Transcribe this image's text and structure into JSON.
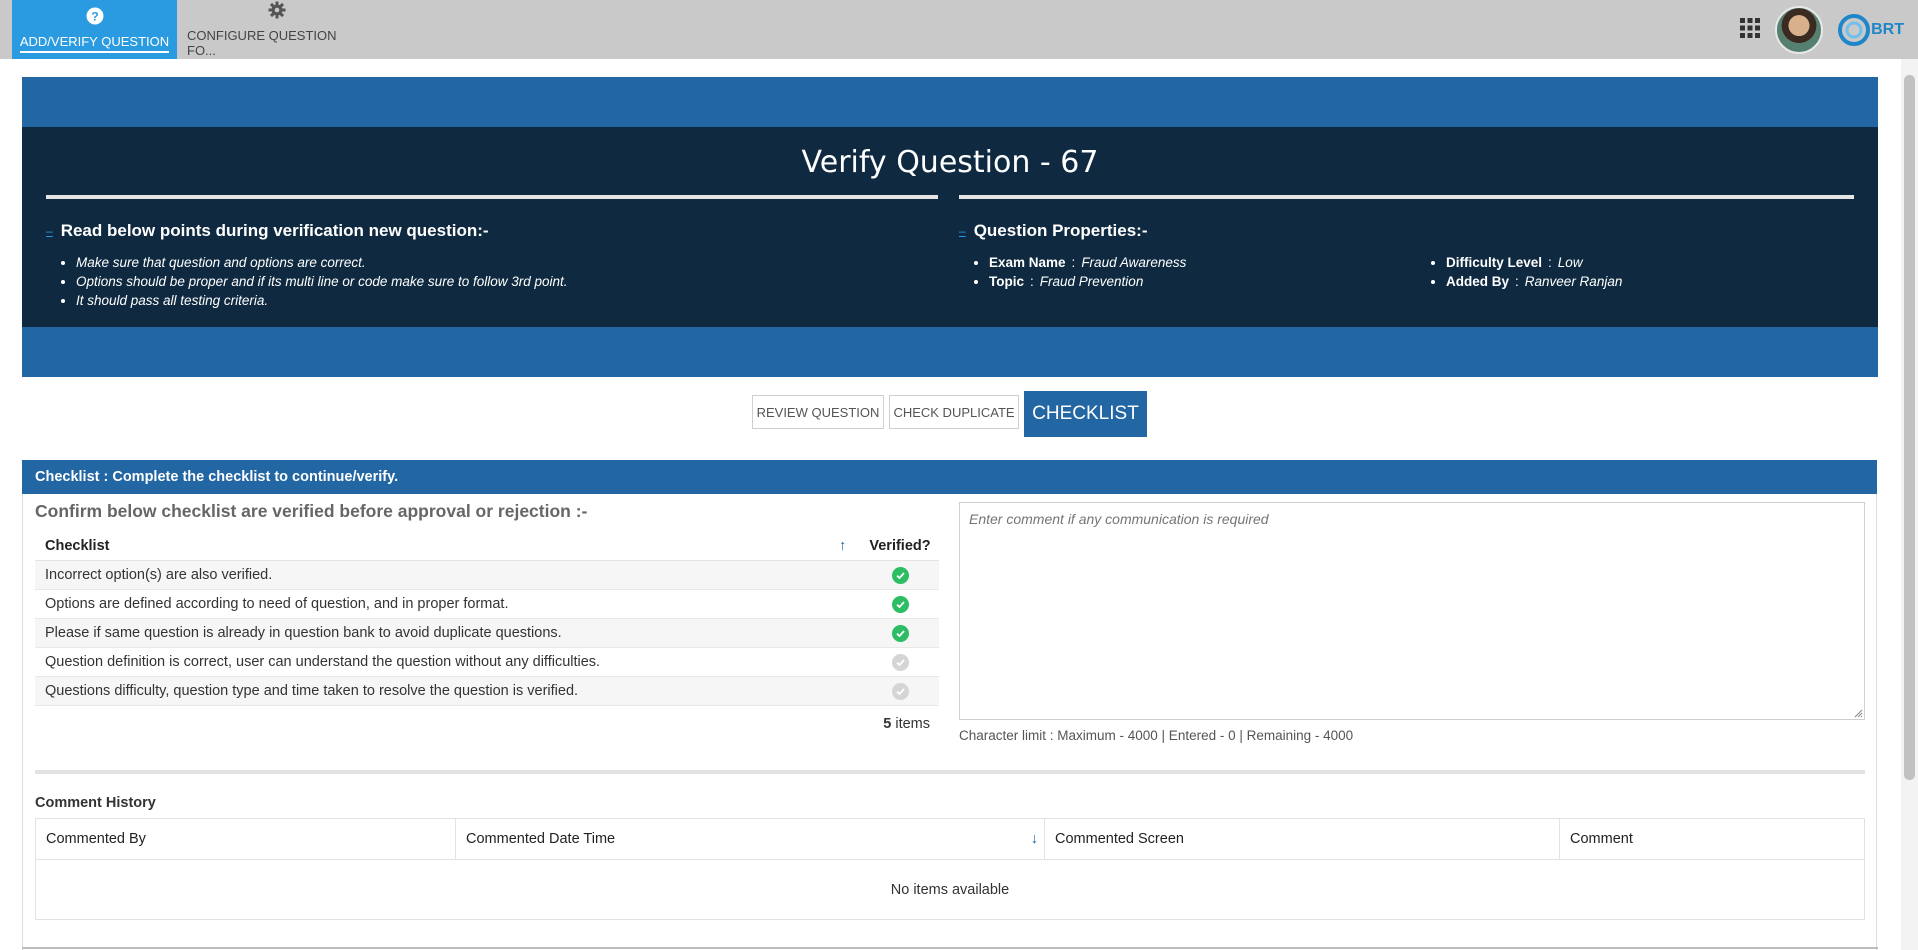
{
  "nav": {
    "tabs": [
      {
        "label": "ADD/VERIFY QUESTION",
        "icon": "question-circle-icon",
        "active": true
      },
      {
        "label": "CONFIGURE QUESTION FO...",
        "icon": "gear-icon",
        "active": false
      }
    ],
    "logo_text": "BRT"
  },
  "banner": {
    "title": "Verify Question - 67",
    "instructions_title": "Read below points during verification new question:-",
    "instructions": [
      "Make sure that question and options are correct.",
      "Options should be proper and if its multi line or code make sure to follow 3rd point.",
      "It should pass all testing criteria."
    ],
    "properties_title": "Question Properties:-",
    "properties": {
      "exam_name": {
        "label": "Exam Name",
        "value": "Fraud Awareness"
      },
      "topic": {
        "label": "Topic",
        "value": "Fraud Prevention"
      },
      "difficulty": {
        "label": "Difficulty Level",
        "value": "Low"
      },
      "added_by": {
        "label": "Added By",
        "value": "Ranveer Ranjan"
      }
    }
  },
  "tabs": {
    "review": "REVIEW QUESTION",
    "duplicate": "CHECK DUPLICATE",
    "checklist": "CHECKLIST"
  },
  "checklist": {
    "panel_title": "Checklist : Complete the checklist to continue/verify.",
    "confirm_title": "Confirm below checklist are verified before approval or rejection :-",
    "col_item": "Checklist",
    "col_verified": "Verified?",
    "rows": [
      {
        "text": "Incorrect option(s) are also verified.",
        "verified": true
      },
      {
        "text": "Options are defined according to need of question, and in proper format.",
        "verified": true
      },
      {
        "text": "Please if same question is already in question bank to avoid duplicate questions.",
        "verified": true
      },
      {
        "text": "Question definition is correct, user can understand the question without any difficulties.",
        "verified": false
      },
      {
        "text": "Questions difficulty, question type and time taken to resolve the question is verified.",
        "verified": false
      }
    ],
    "count": "5",
    "count_label": "items"
  },
  "comment": {
    "placeholder": "Enter comment if any communication is required",
    "value": "",
    "char_limit": "Character limit : Maximum - 4000 | Entered - 0 | Remaining - 4000"
  },
  "history": {
    "title": "Comment History",
    "columns": [
      "Commented By",
      "Commented Date Time",
      "Commented Screen",
      "Comment"
    ],
    "empty": "No items available"
  },
  "colors": {
    "accent": "#2266a3",
    "nav_active": "#2a9be0",
    "banner_dark": "#0f2a40",
    "success": "#2dbd64"
  }
}
